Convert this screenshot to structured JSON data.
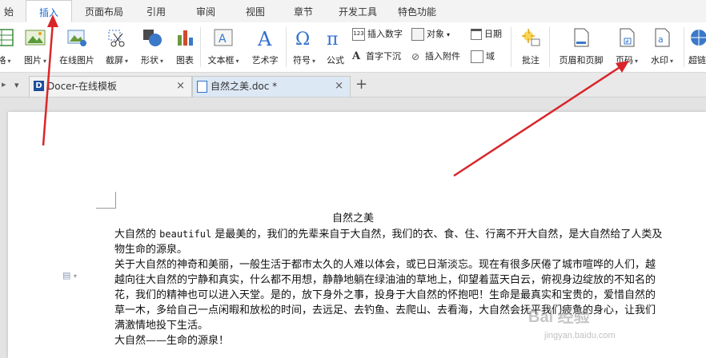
{
  "menubar": {
    "tabs": [
      {
        "label": "始",
        "active": false
      },
      {
        "label": "插入",
        "active": true
      },
      {
        "label": "页面布局",
        "active": false
      },
      {
        "label": "引用",
        "active": false
      },
      {
        "label": "审阅",
        "active": false
      },
      {
        "label": "视图",
        "active": false
      },
      {
        "label": "章节",
        "active": false
      },
      {
        "label": "开发工具",
        "active": false
      },
      {
        "label": "特色功能",
        "active": false
      }
    ]
  },
  "ribbon": {
    "table_label": "格",
    "picture_label": "图片",
    "online_picture_label": "在线图片",
    "screenshot_label": "截屏",
    "shape_label": "形状",
    "chart_label": "图表",
    "textbox_label": "文本框",
    "wordart_label": "艺术字",
    "symbol_label": "符号",
    "formula_label": "公式",
    "insert_number_label": "插入数字",
    "object_label": "对象",
    "date_label": "日期",
    "dropcap_label": "首字下沉",
    "attachment_label": "插入附件",
    "field_label": "域",
    "comment_label": "批注",
    "header_footer_label": "页眉和页脚",
    "page_number_label": "页码",
    "watermark_label": "水印",
    "hyperlink_label": "超链"
  },
  "doc_tabs": [
    {
      "label": "Docer-在线模板",
      "active": false
    },
    {
      "label": "自然之美.doc *",
      "active": true
    }
  ],
  "document": {
    "title": "自然之美",
    "p1_word": "beautiful",
    "lines": [
      "大自然的",
      "是最美的，我们的先辈来自于大自然，我们的衣、食、住、行离不开大自然，是大自然给了人类及",
      "物生命的源泉。",
      "关于大自然的神奇和美丽，一般生活于都市太久的人难以体会，或已日渐淡忘。现在有很多厌倦了城市喧哗的人们，越",
      "越向往大自然的宁静和真实，什么都不用想，静静地躺在绿油油的草地上，仰望着蓝天白云，俯视身边绽放的不知名的",
      "花，我们的精神也可以进入天堂。是的，放下身外之事，投身于大自然的怀抱吧！生命是最真实和宝贵的，爱惜自然的",
      "草一木，多给自己一点闲暇和放松的时间，去远足、去钓鱼、去爬山、去看海，大自然会抚平我们疲惫的身心，让我们",
      "满激情地投下生活。",
      "大自然——生命的源泉！"
    ]
  },
  "watermark": {
    "text": "Bai 经验",
    "sub": "jingyan.baidu.com"
  },
  "colors": {
    "accent": "#1b6ad6",
    "arrow": "#d9262b"
  }
}
